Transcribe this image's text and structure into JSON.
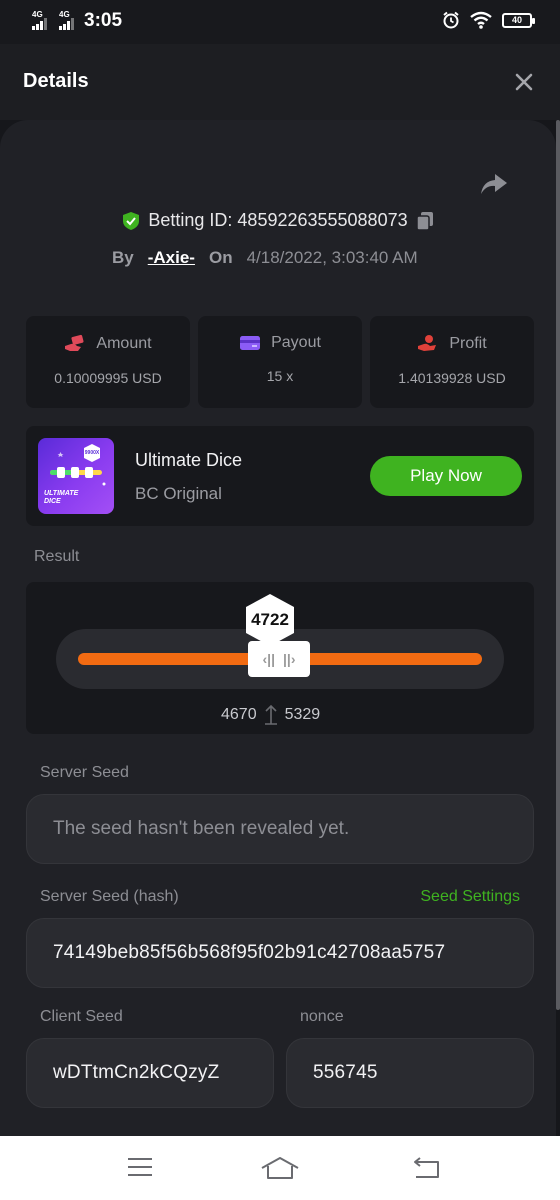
{
  "status_bar": {
    "network1": "4G",
    "network2": "4G",
    "time": "3:05",
    "battery": "40"
  },
  "header": {
    "title": "Details"
  },
  "bet": {
    "betting_id": "Betting ID: 48592263555088073",
    "by_label": "By",
    "user": "-Axie-",
    "on_label": "On",
    "date": "4/18/2022, 3:03:40 AM"
  },
  "stats": [
    {
      "label": "Amount",
      "value": "0.10009995 USD",
      "icon": "money-hand-icon",
      "color": "#e04a5a"
    },
    {
      "label": "Payout",
      "value": "15 x",
      "icon": "card-icon",
      "color": "#8b5cf6"
    },
    {
      "label": "Profit",
      "value": "1.40139928 USD",
      "icon": "profit-hand-icon",
      "color": "#e0413a"
    }
  ],
  "game": {
    "name": "Ultimate Dice",
    "subtitle": "BC Original",
    "play_label": "Play Now",
    "thumb_text": "ULTIMATE DICE",
    "thumb_badge": "9900X"
  },
  "result": {
    "label": "Result",
    "value": "4722",
    "range_low": "4670",
    "range_high": "5329"
  },
  "server_seed": {
    "label": "Server Seed",
    "placeholder": "The seed hasn't been revealed yet."
  },
  "server_seed_hash": {
    "label": "Server Seed (hash)",
    "settings_link": "Seed Settings",
    "value": "74149beb85f56b568f95f02b91c42708aa5757"
  },
  "client_seed": {
    "label": "Client Seed",
    "value": "wDTtmCn2kCQzyZ"
  },
  "nonce": {
    "label": "nonce",
    "value": "556745"
  },
  "colors": {
    "accent_green": "#3fb320",
    "accent_orange": "#f26b12",
    "background": "#16171b"
  }
}
